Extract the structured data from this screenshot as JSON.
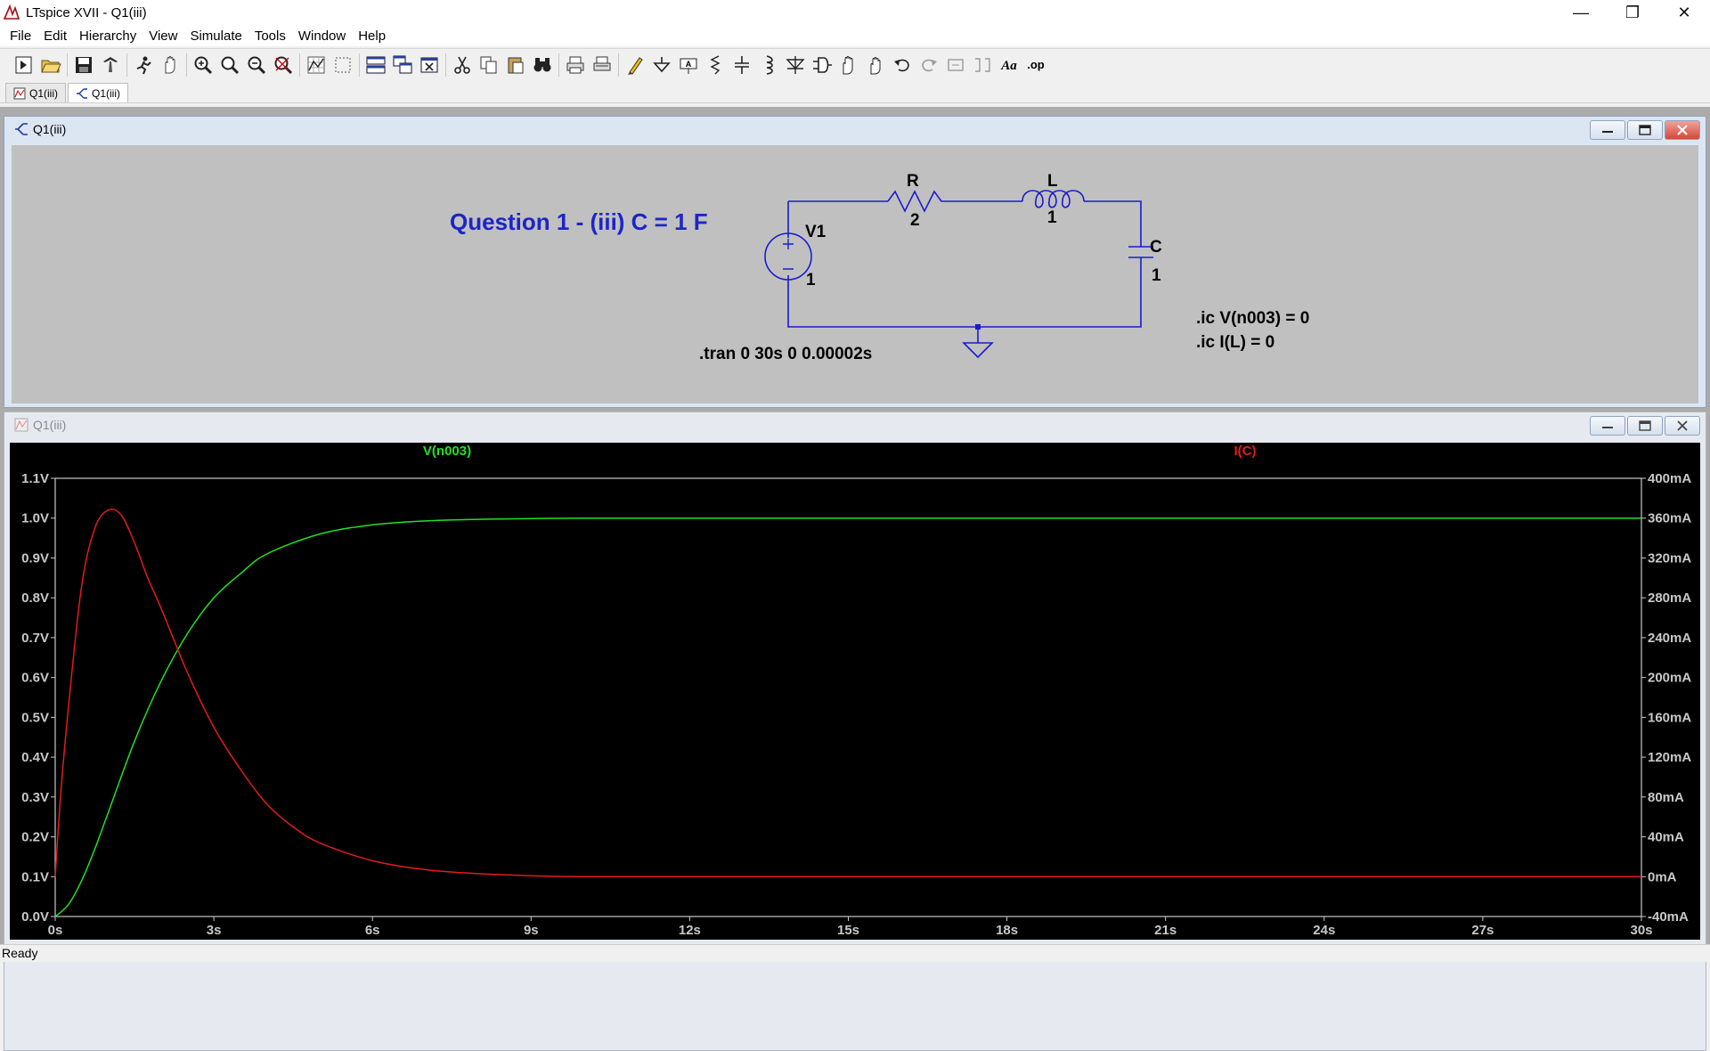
{
  "window": {
    "title": "LTspice XVII - Q1(iii)",
    "minimize": "—",
    "restore": "❐",
    "close": "✕"
  },
  "menu": [
    "File",
    "Edit",
    "Hierarchy",
    "View",
    "Simulate",
    "Tools",
    "Window",
    "Help"
  ],
  "toolbar_icons": [
    "open-schematic-icon",
    "open-file-icon",
    "save-icon",
    "control-panel-icon",
    "run-icon",
    "halt-icon",
    "zoom-in-icon",
    "zoom-area-icon",
    "zoom-out-icon",
    "zoom-cancel-icon",
    "autorange-icon",
    "zoom-extent-icon",
    "tile-icon",
    "cascade-icon",
    "close-all-icon",
    "cut-icon",
    "copy-icon",
    "paste-icon",
    "find-icon",
    "print-icon",
    "print-preview-icon",
    "draw-wire-icon",
    "ground-icon",
    "label-net-icon",
    "resistor-icon",
    "capacitor-icon",
    "inductor-icon",
    "diode-icon",
    "component-icon",
    "move-icon",
    "drag-icon",
    "undo-icon",
    "redo-icon",
    "rotate-icon",
    "mirror-icon",
    "text-icon",
    "spice-directive-icon"
  ],
  "toolbar_labels": {
    "text": "Aa",
    "op": ".op"
  },
  "tabs": [
    {
      "label": "Q1(iii)",
      "kind": "waveform"
    },
    {
      "label": "Q1(iii)",
      "kind": "schematic"
    }
  ],
  "schematic": {
    "window_title": "Q1(iii)",
    "heading": "Question 1 - (iii) C = 1 F",
    "components": {
      "v1": {
        "name": "V1",
        "value": "1"
      },
      "r": {
        "name": "R",
        "value": "2"
      },
      "l": {
        "name": "L",
        "value": "1"
      },
      "c": {
        "name": "C",
        "value": "1"
      }
    },
    "directives": {
      "tran": ".tran 0 30s 0 0.00002s",
      "ic_v": ".ic V(n003) = 0",
      "ic_i": ".ic I(L) = 0"
    },
    "wire_color": "#1a1ad4"
  },
  "waveform": {
    "window_title": "Q1(iii)"
  },
  "chart_data": {
    "type": "line",
    "x_unit": "s",
    "xlim": [
      0,
      30
    ],
    "x_ticks": [
      "0s",
      "3s",
      "6s",
      "9s",
      "12s",
      "15s",
      "18s",
      "21s",
      "24s",
      "27s",
      "30s"
    ],
    "y_left_ticks": [
      "1.1V",
      "1.0V",
      "0.9V",
      "0.8V",
      "0.7V",
      "0.6V",
      "0.5V",
      "0.4V",
      "0.3V",
      "0.2V",
      "0.1V",
      "0.0V"
    ],
    "y_right_ticks": [
      "400mA",
      "360mA",
      "320mA",
      "280mA",
      "240mA",
      "200mA",
      "160mA",
      "120mA",
      "80mA",
      "40mA",
      "0mA",
      "-40mA"
    ],
    "ylim_left": [
      0,
      1.1
    ],
    "ylim_right": [
      -40,
      400
    ],
    "series": [
      {
        "name": "V(n003)",
        "axis": "left",
        "color": "#22e022",
        "x": [
          0,
          0.25,
          0.5,
          0.75,
          1,
          1.5,
          2,
          2.5,
          3,
          3.5,
          4,
          5,
          6,
          7,
          8,
          9,
          10,
          12,
          15,
          20,
          25,
          30
        ],
        "y": [
          0,
          0.03,
          0.09,
          0.17,
          0.26,
          0.44,
          0.59,
          0.71,
          0.8,
          0.86,
          0.91,
          0.96,
          0.983,
          0.993,
          0.997,
          0.999,
          1.0,
          1.0,
          1.0,
          1.0,
          1.0,
          1.0
        ]
      },
      {
        "name": "I(C)",
        "axis": "right",
        "color": "#e01c1c",
        "x": [
          0,
          0.1,
          0.25,
          0.5,
          0.75,
          1,
          1.25,
          1.5,
          1.75,
          2,
          2.5,
          3,
          3.5,
          4,
          4.5,
          5,
          6,
          7,
          8,
          9,
          10,
          12,
          15,
          20,
          25,
          30
        ],
        "y": [
          0,
          80,
          170,
          292,
          350,
          368,
          363,
          335,
          300,
          270,
          205,
          150,
          108,
          73,
          50,
          34,
          16,
          7,
          3,
          1,
          0,
          0,
          0,
          0,
          0,
          0
        ]
      }
    ]
  },
  "status": "Ready"
}
